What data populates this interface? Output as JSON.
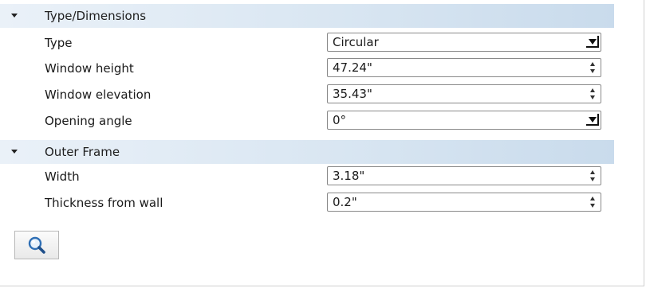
{
  "sections": [
    {
      "title": "Type/Dimensions",
      "rows": [
        {
          "label": "Type",
          "value": "Circular",
          "control": "dropdown"
        },
        {
          "label": "Window height",
          "value": "47.24\"",
          "control": "spinner"
        },
        {
          "label": "Window elevation",
          "value": "35.43\"",
          "control": "spinner"
        },
        {
          "label": "Opening angle",
          "value": "0°",
          "control": "dropdown"
        }
      ]
    },
    {
      "title": "Outer Frame",
      "rows": [
        {
          "label": "Width",
          "value": "3.18\"",
          "control": "spinner"
        },
        {
          "label": "Thickness from wall",
          "value": "0.2\"",
          "control": "spinner"
        }
      ]
    }
  ],
  "search_button": {
    "icon": "magnifier-icon"
  },
  "colors": {
    "header_gradient_start": "#eaf1f8",
    "header_gradient_end": "#c9dbec",
    "search_icon_blue": "#2f6fb5"
  }
}
